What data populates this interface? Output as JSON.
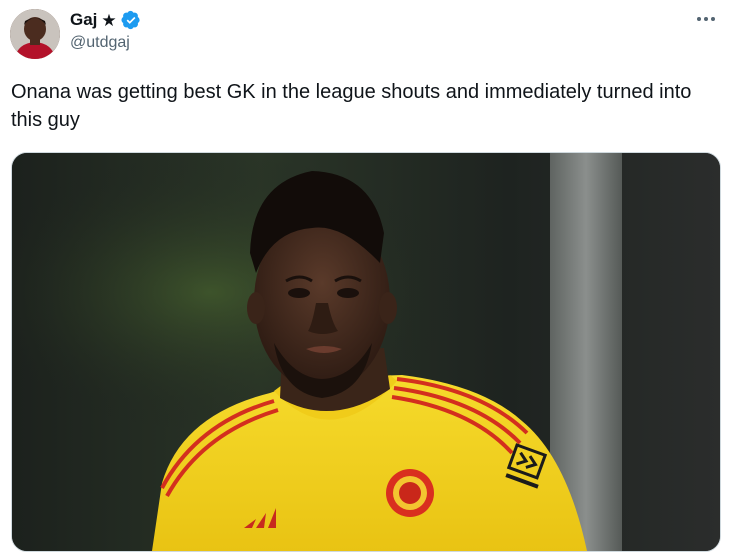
{
  "author": {
    "display_name": "Gaj",
    "handle": "@utdgaj",
    "star_icon": "★",
    "verified": true,
    "verified_color": "#1d9bf0"
  },
  "tweet": {
    "text": "Onana was getting best GK in the league shouts and immediately turned into this guy"
  },
  "media": {
    "description_icon": "photo",
    "shirt_color": "#f3d322"
  },
  "menu": {
    "icon": "more-options-icon"
  }
}
